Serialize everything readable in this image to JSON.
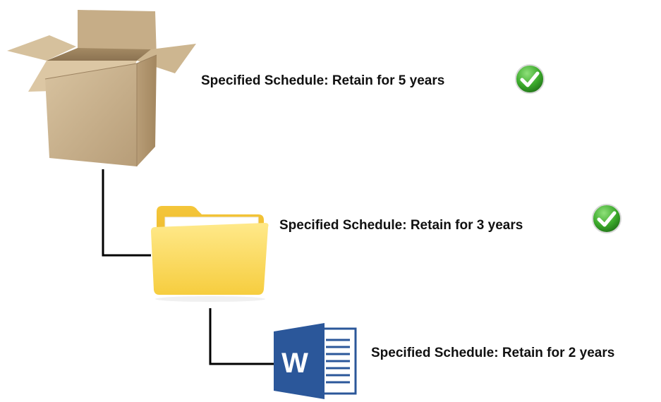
{
  "hierarchy": {
    "box": {
      "icon": "cardboard-box-icon",
      "label": "Specified Schedule: Retain for 5 years",
      "status_icon": "check-mark-icon"
    },
    "folder": {
      "icon": "folder-icon",
      "label": "Specified Schedule: Retain for 3 years",
      "status_icon": "check-mark-icon"
    },
    "document": {
      "icon": "word-document-icon",
      "glyph": "W",
      "label": "Specified Schedule: Retain for 2 years"
    }
  },
  "colors": {
    "connector": "#000000",
    "check_green": "#3aa82a",
    "word_blue": "#2b579a",
    "folder_yellow": "#f9d54a",
    "box_tan": "#c9b08a"
  }
}
